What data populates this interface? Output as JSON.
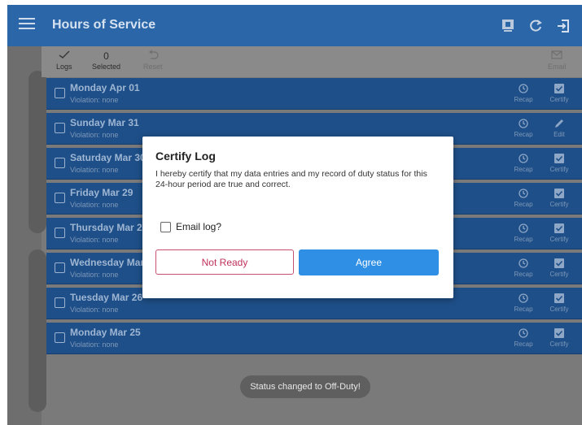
{
  "appbar": {
    "title": "Hours of Service"
  },
  "toolbar": {
    "logs": {
      "icon": "check-icon",
      "label": "Logs"
    },
    "selected": {
      "count": "0",
      "label": "Selected"
    },
    "reset": {
      "label": "Reset"
    },
    "email": {
      "label": "Email"
    }
  },
  "rows": [
    {
      "date": "Monday Apr 01",
      "violation": "Violation: none",
      "recap": "Recap",
      "action": "Certify",
      "action_icon": "certify-icon"
    },
    {
      "date": "Sunday Mar 31",
      "violation": "Violation: none",
      "recap": "Recap",
      "action": "Edit",
      "action_icon": "edit-icon"
    },
    {
      "date": "Saturday Mar 30",
      "violation": "Violation: none",
      "recap": "Recap",
      "action": "Certify",
      "action_icon": "certify-icon"
    },
    {
      "date": "Friday Mar 29",
      "violation": "Violation: none",
      "recap": "Recap",
      "action": "Certify",
      "action_icon": "certify-icon"
    },
    {
      "date": "Thursday Mar 28",
      "violation": "Violation: none",
      "recap": "Recap",
      "action": "Certify",
      "action_icon": "certify-icon"
    },
    {
      "date": "Wednesday Mar 27",
      "violation": "Violation: none",
      "recap": "Recap",
      "action": "Certify",
      "action_icon": "certify-icon"
    },
    {
      "date": "Tuesday Mar 26",
      "violation": "Violation: none",
      "recap": "Recap",
      "action": "Certify",
      "action_icon": "certify-icon"
    },
    {
      "date": "Monday Mar 25",
      "violation": "Violation: none",
      "recap": "Recap",
      "action": "Certify",
      "action_icon": "certify-icon"
    }
  ],
  "dialog": {
    "title": "Certify Log",
    "text": "I hereby certify that my data entries and my record of duty status for this 24-hour period are true and correct.",
    "email_label": "Email log?",
    "not_ready": "Not Ready",
    "agree": "Agree"
  },
  "toast": "Status changed to Off-Duty!",
  "colors": {
    "appbar": "#2a66a8",
    "row": "#1e4f88",
    "agree": "#2e8fe4",
    "not_ready": "#c0325a"
  }
}
